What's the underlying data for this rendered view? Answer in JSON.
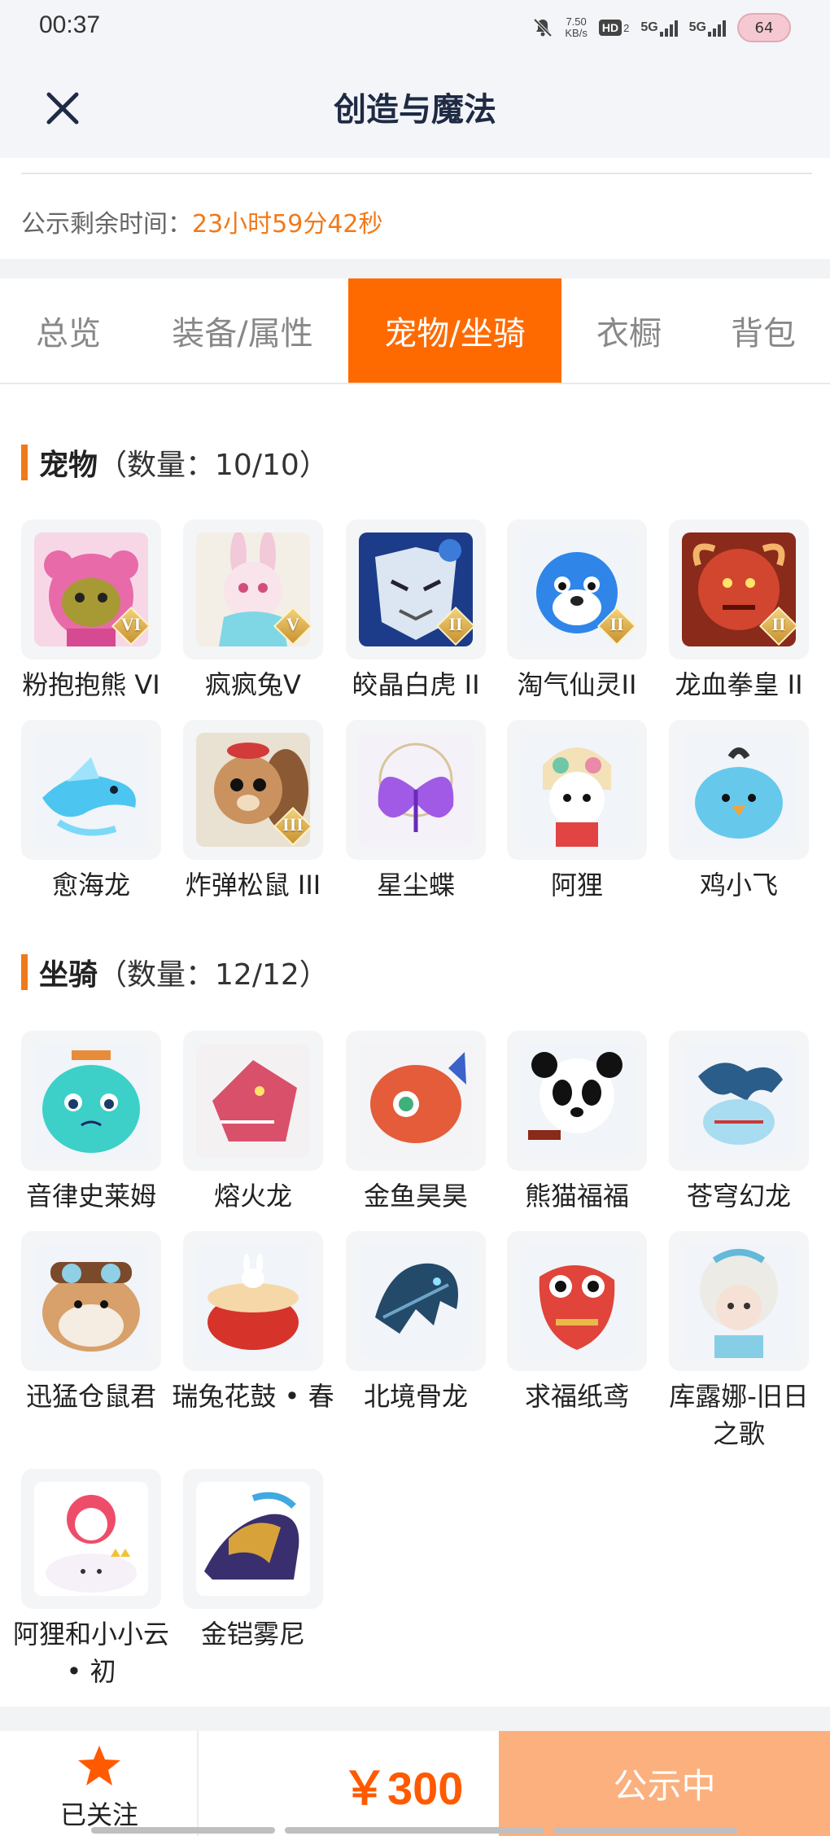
{
  "status_bar": {
    "time": "00:37",
    "net_speed_value": "7.50",
    "net_speed_unit": "KB/s",
    "hd_label": "HD",
    "hd_sub": "2",
    "signal1_label": "5G",
    "signal2_label": "5G",
    "battery": "64"
  },
  "header": {
    "title": "创造与魔法"
  },
  "countdown": {
    "label": "公示剩余时间：",
    "value": "23小时59分42秒"
  },
  "tabs": [
    {
      "label": "总览"
    },
    {
      "label": "装备/属性"
    },
    {
      "label": "宠物/坐骑",
      "active": true
    },
    {
      "label": "衣橱"
    },
    {
      "label": "背包"
    }
  ],
  "pets": {
    "title": "宠物",
    "count": "（数量：10/10）",
    "items": [
      {
        "name": "粉抱抱熊 VI",
        "rank": "VI",
        "icon": "pink-bear"
      },
      {
        "name": "疯疯兔V",
        "rank": "V",
        "icon": "crazy-rabbit"
      },
      {
        "name": "皎晶白虎 II",
        "rank": "II",
        "icon": "crystal-white-tiger"
      },
      {
        "name": "淘气仙灵II",
        "rank": "II",
        "icon": "naughty-sprite"
      },
      {
        "name": "龙血拳皇 II",
        "rank": "II",
        "icon": "dragon-blood-boxer"
      },
      {
        "name": "愈海龙",
        "rank": "",
        "icon": "healing-sea-dragon"
      },
      {
        "name": "炸弹松鼠 III",
        "rank": "III",
        "icon": "bomb-squirrel"
      },
      {
        "name": "星尘蝶",
        "rank": "",
        "icon": "stardust-butterfly"
      },
      {
        "name": "阿狸",
        "rank": "",
        "icon": "ali-fox"
      },
      {
        "name": "鸡小飞",
        "rank": "",
        "icon": "little-chick"
      }
    ]
  },
  "mounts": {
    "title": "坐骑",
    "count": "（数量：12/12）",
    "items": [
      {
        "name": "音律史莱姆",
        "icon": "melody-slime"
      },
      {
        "name": "熔火龙",
        "icon": "molten-dragon"
      },
      {
        "name": "金鱼昊昊",
        "icon": "goldfish"
      },
      {
        "name": "熊猫福福",
        "icon": "panda"
      },
      {
        "name": "苍穹幻龙",
        "icon": "sky-dragon"
      },
      {
        "name": "迅猛仓鼠君",
        "icon": "hamster"
      },
      {
        "name": "瑞兔花鼓 • 春",
        "icon": "rabbit-drum"
      },
      {
        "name": "北境骨龙",
        "icon": "bone-dragon"
      },
      {
        "name": "求福纸鸢",
        "icon": "paper-kite-fish"
      },
      {
        "name": "库露娜-旧日之歌",
        "icon": "kuluna"
      },
      {
        "name": "阿狸和小小云 • 初",
        "icon": "ali-and-cloud"
      },
      {
        "name": "金铠雾尼",
        "icon": "golden-armor-dragon"
      }
    ]
  },
  "bottom_bar": {
    "follow_label": "已关注",
    "price": "￥300",
    "status_label": "公示中"
  },
  "colors": {
    "accent": "#ff6a00",
    "countdown": "#f07a1a",
    "price": "#ff5a00",
    "status_button": "#fbb07e"
  }
}
